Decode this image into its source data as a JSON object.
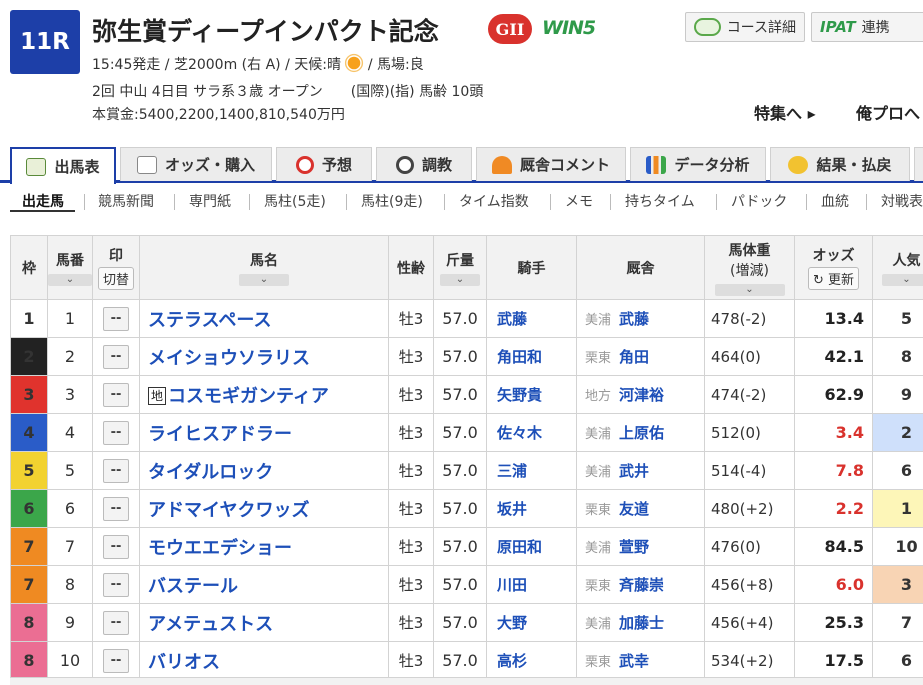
{
  "race": {
    "number": "11R",
    "title": "弥生賞ディープインパクト記念",
    "grade": "GII",
    "win5": "WIN5",
    "line1_pre": "15:45発走 / 芝2000m (右 A) / 天候:晴",
    "line1_post": " / 馬場:良",
    "line2": "2回 中山 4日目 サラ系３歳 オープン　　(国際)(指) 馬齢 10頭",
    "line3": "本賞金:5400,2200,1400,810,540万円"
  },
  "header_buttons": {
    "course": "コース詳細",
    "ipat_logo": "IPAT",
    "ipat_label": "連携",
    "feature": "特集へ ▸",
    "mypro": "俺プロへ"
  },
  "main_tabs": [
    "出馬表",
    "オッズ・購入",
    "予想",
    "調教",
    "厩舎コメント",
    "データ分析",
    "結果・払戻"
  ],
  "sub_tabs": [
    "出走馬",
    "競馬新聞",
    "専門紙",
    "馬柱(5走)",
    "馬柱(9走)",
    "タイム指数",
    "メモ",
    "持ちタイム",
    "パドック",
    "血統",
    "対戦表"
  ],
  "table": {
    "headers": {
      "waku": "枠",
      "umaban": "馬番",
      "mark": "印",
      "mark_btn": "切替",
      "name": "馬名",
      "sexage": "性齢",
      "weight": "斤量",
      "jockey": "騎手",
      "stable": "厩舎",
      "body_weight": "馬体重",
      "body_weight_sub": "(増減)",
      "odds": "オッズ",
      "odds_btn": "更新",
      "popularity": "人気"
    },
    "mark_placeholder": "--",
    "rows": [
      {
        "waku": "1",
        "umaban": "1",
        "name": "ステラスペース",
        "chi": "",
        "sexage": "牡3",
        "weight": "57.0",
        "jockey": "武藤",
        "region": "美浦",
        "trainer": "武藤",
        "body_weight": "478(-2)",
        "odds": "13.4",
        "popularity": "5"
      },
      {
        "waku": "2",
        "umaban": "2",
        "name": "メイショウソラリス",
        "chi": "",
        "sexage": "牡3",
        "weight": "57.0",
        "jockey": "角田和",
        "region": "栗東",
        "trainer": "角田",
        "body_weight": "464(0)",
        "odds": "42.1",
        "popularity": "8"
      },
      {
        "waku": "3",
        "umaban": "3",
        "name": "コスモギガンティア",
        "chi": "地",
        "sexage": "牡3",
        "weight": "57.0",
        "jockey": "矢野貴",
        "region": "地方",
        "trainer": "河津裕",
        "body_weight": "474(-2)",
        "odds": "62.9",
        "popularity": "9"
      },
      {
        "waku": "4",
        "umaban": "4",
        "name": "ライヒスアドラー",
        "chi": "",
        "sexage": "牡3",
        "weight": "57.0",
        "jockey": "佐々木",
        "region": "美浦",
        "trainer": "上原佑",
        "body_weight": "512(0)",
        "odds": "3.4",
        "popularity": "2"
      },
      {
        "waku": "5",
        "umaban": "5",
        "name": "タイダルロック",
        "chi": "",
        "sexage": "牡3",
        "weight": "57.0",
        "jockey": "三浦",
        "region": "美浦",
        "trainer": "武井",
        "body_weight": "514(-4)",
        "odds": "7.8",
        "popularity": "6"
      },
      {
        "waku": "6",
        "umaban": "6",
        "name": "アドマイヤクワッズ",
        "chi": "",
        "sexage": "牡3",
        "weight": "57.0",
        "jockey": "坂井",
        "region": "栗東",
        "trainer": "友道",
        "body_weight": "480(+2)",
        "odds": "2.2",
        "popularity": "1"
      },
      {
        "waku": "7",
        "umaban": "7",
        "name": "モウエエデショー",
        "chi": "",
        "sexage": "牡3",
        "weight": "57.0",
        "jockey": "原田和",
        "region": "美浦",
        "trainer": "萱野",
        "body_weight": "476(0)",
        "odds": "84.5",
        "popularity": "10"
      },
      {
        "waku": "7",
        "umaban": "8",
        "name": "バステール",
        "chi": "",
        "sexage": "牡3",
        "weight": "57.0",
        "jockey": "川田",
        "region": "栗東",
        "trainer": "斉藤崇",
        "body_weight": "456(+8)",
        "odds": "6.0",
        "popularity": "3"
      },
      {
        "waku": "8",
        "umaban": "9",
        "name": "アメテュストス",
        "chi": "",
        "sexage": "牡3",
        "weight": "57.0",
        "jockey": "大野",
        "region": "美浦",
        "trainer": "加藤士",
        "body_weight": "456(+4)",
        "odds": "25.3",
        "popularity": "7"
      },
      {
        "waku": "8",
        "umaban": "10",
        "name": "バリオス",
        "chi": "",
        "sexage": "牡3",
        "weight": "57.0",
        "jockey": "高杉",
        "region": "栗東",
        "trainer": "武幸",
        "body_weight": "534(+2)",
        "odds": "17.5",
        "popularity": "6"
      }
    ]
  },
  "colors": {
    "race_badge": "#1d3fa8",
    "grade": "#d9322d",
    "link_blue": "#1d4fb8",
    "odds_hot": "#d9322d",
    "pop1_bg": "#fdf6b8",
    "pop2_bg": "#cfe0fb",
    "pop3_bg": "#f8d4b4"
  },
  "icons": {
    "weather": "sun-icon",
    "tabs": [
      "table-icon",
      "ticket-icon",
      "target-icon",
      "stopwatch-icon",
      "stable-icon",
      "bar-chart-icon",
      "coins-icon"
    ]
  }
}
